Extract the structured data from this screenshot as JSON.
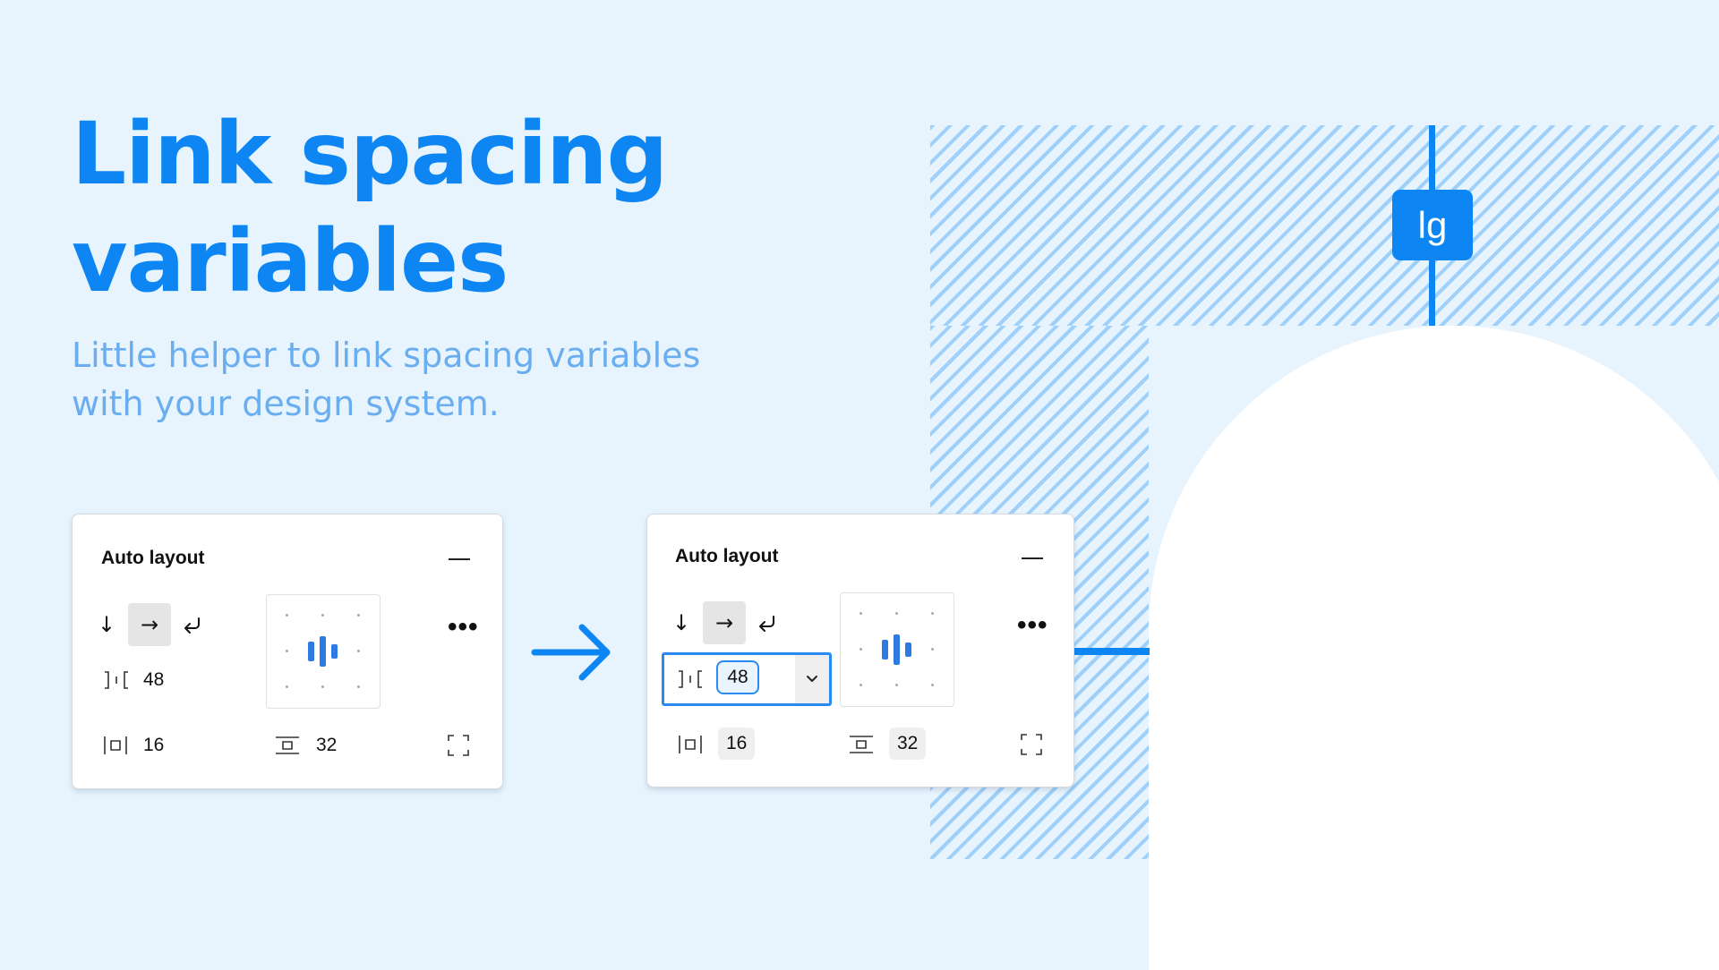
{
  "hero": {
    "title_line1": "Link spacing",
    "title_line2": "variables",
    "subtitle_line1": "Little helper to link spacing variables",
    "subtitle_line2": "with your design system."
  },
  "badge": {
    "label": "lg"
  },
  "panel_before": {
    "title": "Auto layout",
    "gap_value": "48",
    "horizontal_padding": "16",
    "vertical_padding": "32"
  },
  "panel_after": {
    "title": "Auto layout",
    "gap_value": "48",
    "horizontal_padding": "16",
    "vertical_padding": "32"
  },
  "colors": {
    "accent": "#0d86f3",
    "background": "#e7f4fd",
    "subtitle": "#6aaef0",
    "focus_border": "#2a8aef"
  }
}
